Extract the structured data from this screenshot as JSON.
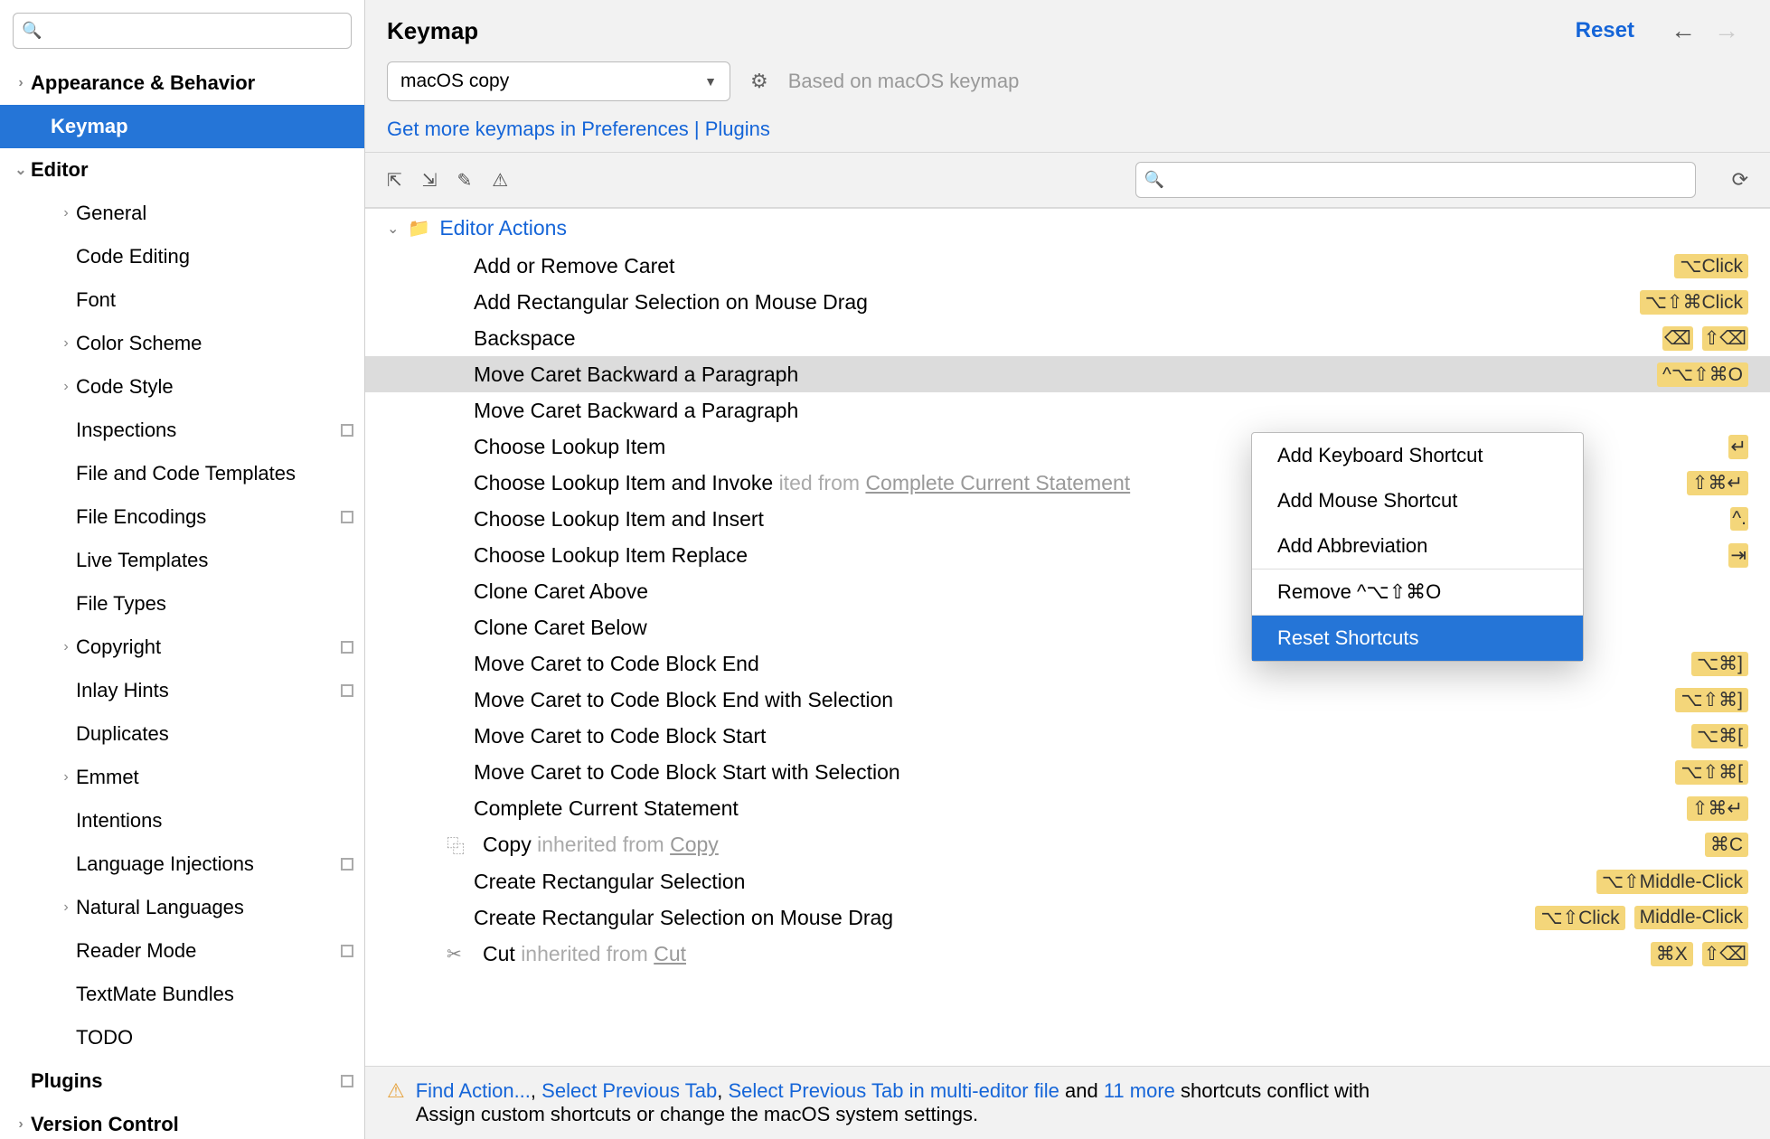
{
  "page": {
    "title": "Keymap",
    "reset": "Reset"
  },
  "keymap": {
    "selected": "macOS copy",
    "based_on": "Based on macOS keymap",
    "more_link": "Get more keymaps in Preferences | Plugins"
  },
  "sidebar": {
    "search_placeholder": "",
    "items": [
      {
        "label": "Appearance & Behavior",
        "bold": true,
        "chev": "›",
        "indent": 0
      },
      {
        "label": "Keymap",
        "bold": true,
        "chev": "",
        "indent": 1,
        "selected": true
      },
      {
        "label": "Editor",
        "bold": true,
        "chev": "⌄",
        "indent": 0
      },
      {
        "label": "General",
        "chev": "›",
        "indent": 2
      },
      {
        "label": "Code Editing",
        "chev": "",
        "indent": 2
      },
      {
        "label": "Font",
        "chev": "",
        "indent": 2
      },
      {
        "label": "Color Scheme",
        "chev": "›",
        "indent": 2
      },
      {
        "label": "Code Style",
        "chev": "›",
        "indent": 2
      },
      {
        "label": "Inspections",
        "chev": "",
        "indent": 2,
        "box": true
      },
      {
        "label": "File and Code Templates",
        "chev": "",
        "indent": 2
      },
      {
        "label": "File Encodings",
        "chev": "",
        "indent": 2,
        "box": true
      },
      {
        "label": "Live Templates",
        "chev": "",
        "indent": 2
      },
      {
        "label": "File Types",
        "chev": "",
        "indent": 2
      },
      {
        "label": "Copyright",
        "chev": "›",
        "indent": 2,
        "box": true
      },
      {
        "label": "Inlay Hints",
        "chev": "",
        "indent": 2,
        "box": true
      },
      {
        "label": "Duplicates",
        "chev": "",
        "indent": 2
      },
      {
        "label": "Emmet",
        "chev": "›",
        "indent": 2
      },
      {
        "label": "Intentions",
        "chev": "",
        "indent": 2
      },
      {
        "label": "Language Injections",
        "chev": "",
        "indent": 2,
        "box": true
      },
      {
        "label": "Natural Languages",
        "chev": "›",
        "indent": 2
      },
      {
        "label": "Reader Mode",
        "chev": "",
        "indent": 2,
        "box": true
      },
      {
        "label": "TextMate Bundles",
        "chev": "",
        "indent": 2
      },
      {
        "label": "TODO",
        "chev": "",
        "indent": 2
      },
      {
        "label": "Plugins",
        "bold": true,
        "chev": "",
        "indent": 0,
        "box": true
      },
      {
        "label": "Version Control",
        "bold": true,
        "chev": "›",
        "indent": 0
      }
    ]
  },
  "group": {
    "name": "Editor Actions"
  },
  "actions": [
    {
      "name": "Add or Remove Caret",
      "shortcuts": [
        "⌥Click"
      ]
    },
    {
      "name": "Add Rectangular Selection on Mouse Drag",
      "shortcuts": [
        "⌥⇧⌘Click"
      ]
    },
    {
      "name": "Backspace",
      "shortcuts": [],
      "icons": [
        "⌫",
        "⇧⌫"
      ]
    },
    {
      "name": "Move Caret Backward a Paragraph",
      "shortcuts": [
        "^⌥⇧⌘O"
      ],
      "selected": true
    },
    {
      "name": "Move Caret Backward a Paragraph",
      "shortcuts": []
    },
    {
      "name": "Choose Lookup Item",
      "shortcuts": [],
      "icons": [
        "↵"
      ]
    },
    {
      "name": "Choose Lookup Item and Invoke",
      "inherit_prefix": "ited from ",
      "inherit": "Complete Current Statement",
      "shortcuts": [
        "⇧⌘↵"
      ]
    },
    {
      "name": "Choose Lookup Item and Insert",
      "shortcuts": [],
      "icons": [
        "^."
      ]
    },
    {
      "name": "Choose Lookup Item Replace",
      "shortcuts": [],
      "icons": [
        "⇥"
      ]
    },
    {
      "name": "Clone Caret Above",
      "shortcuts": []
    },
    {
      "name": "Clone Caret Below",
      "shortcuts": []
    },
    {
      "name": "Move Caret to Code Block End",
      "shortcuts": [
        "⌥⌘]"
      ]
    },
    {
      "name": "Move Caret to Code Block End with Selection",
      "shortcuts": [
        "⌥⇧⌘]"
      ]
    },
    {
      "name": "Move Caret to Code Block Start",
      "shortcuts": [
        "⌥⌘["
      ]
    },
    {
      "name": "Move Caret to Code Block Start with Selection",
      "shortcuts": [
        "⌥⇧⌘["
      ]
    },
    {
      "name": "Complete Current Statement",
      "shortcuts": [
        "⇧⌘↵"
      ]
    },
    {
      "name": "Copy",
      "row_icon": "⿻",
      "inherit_prefix": "inherited from ",
      "inherit": "Copy",
      "shortcuts": [
        "⌘C"
      ]
    },
    {
      "name": "Create Rectangular Selection",
      "shortcuts": [
        "⌥⇧Middle-Click"
      ]
    },
    {
      "name": "Create Rectangular Selection on Mouse Drag",
      "shortcuts": [
        "⌥⇧Click",
        "Middle-Click"
      ]
    },
    {
      "name": "Cut",
      "row_icon": "✂",
      "inherit_prefix": "inherited from ",
      "inherit": "Cut",
      "shortcuts": [
        "⌘X"
      ],
      "icons": [
        "⇧⌫"
      ]
    }
  ],
  "context_menu": {
    "items": [
      "Add Keyboard Shortcut",
      "Add Mouse Shortcut",
      "Add Abbreviation",
      "Remove ^⌥⇧⌘O",
      "Reset Shortcuts"
    ],
    "selected_index": 4
  },
  "footer": {
    "links": [
      "Find Action...",
      "Select Previous Tab",
      "Select Previous Tab in multi-editor file",
      "11 more"
    ],
    "text_and": " and ",
    "text_tail": " shortcuts conflict with",
    "text_line2": "Assign custom shortcuts or change the macOS system settings."
  }
}
